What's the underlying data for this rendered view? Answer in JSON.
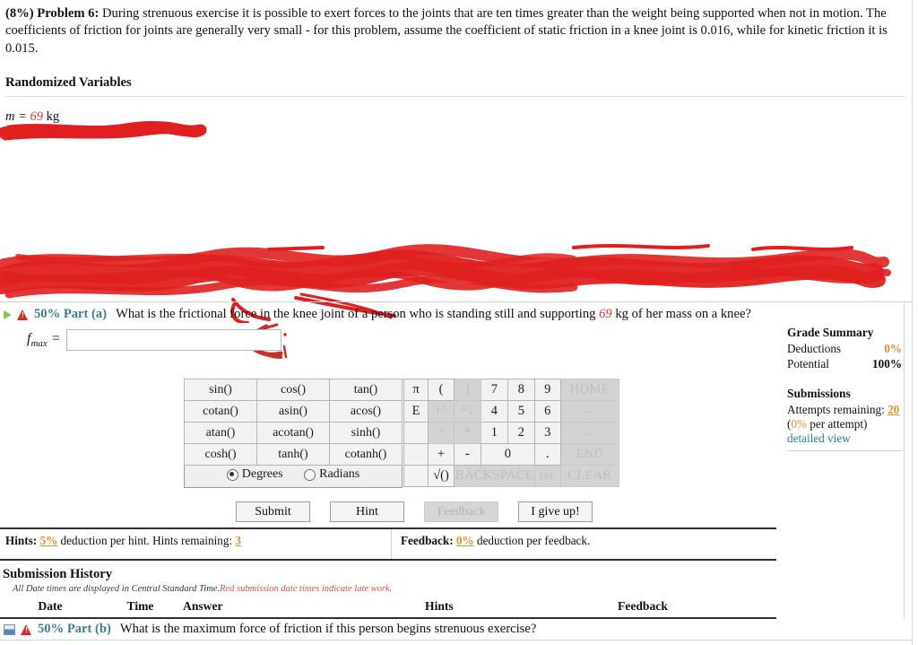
{
  "problem": {
    "percent": "(8%)",
    "number": "Problem 6:",
    "statement": "During strenuous exercise it is possible to exert forces to the joints that are ten times greater than the weight being supported when not in motion. The coefficients of friction for joints are generally very small - for this problem, assume the coefficient of static friction in a knee joint is 0.016, while for kinetic friction it is 0.015.",
    "randomized_title": "Randomized Variables",
    "variable_name": "m =",
    "variable_value": "69",
    "variable_unit": "kg"
  },
  "part_a": {
    "weight_label": "50% Part (a)",
    "question": "What is the frictional force in the knee joint of a person who is standing still and supporting 69 kg of her mass on a knee?",
    "question_pre": "What is the frictional force in the knee joint of a person who is standing still and supporting ",
    "question_value": "69",
    "question_post": " kg of her mass on a knee?",
    "answer_symbol": "f",
    "answer_subscript": "max",
    "answer_equals": "=",
    "answer_value": "",
    "answer_placeholder": ""
  },
  "calculator": {
    "functions": [
      [
        "sin()",
        "cos()",
        "tan()"
      ],
      [
        "cotan()",
        "asin()",
        "acos()"
      ],
      [
        "atan()",
        "acotan()",
        "sinh()"
      ],
      [
        "cosh()",
        "tanh()",
        "cotanh()"
      ]
    ],
    "angle_modes": [
      {
        "label": "Degrees",
        "selected": true
      },
      {
        "label": "Radians",
        "selected": false
      }
    ],
    "keypad_rows": [
      [
        {
          "label": "π",
          "kind": "pe",
          "disabled": false
        },
        {
          "label": "(",
          "kind": "op",
          "disabled": false
        },
        {
          "label": ")",
          "kind": "op",
          "disabled": true
        },
        {
          "label": "7",
          "kind": "num",
          "disabled": false
        },
        {
          "label": "8",
          "kind": "num",
          "disabled": false
        },
        {
          "label": "9",
          "kind": "num",
          "disabled": false
        },
        {
          "label": "HOME",
          "kind": "cmd",
          "disabled": true
        }
      ],
      [
        {
          "label": "E",
          "kind": "pe",
          "disabled": false
        },
        {
          "label": "↑^",
          "kind": "op",
          "disabled": true
        },
        {
          "label": "^↓",
          "kind": "op",
          "disabled": true
        },
        {
          "label": "4",
          "kind": "num",
          "disabled": false
        },
        {
          "label": "5",
          "kind": "num",
          "disabled": false
        },
        {
          "label": "6",
          "kind": "num",
          "disabled": false
        },
        {
          "label": "←",
          "kind": "cmd",
          "disabled": true
        }
      ],
      [
        {
          "label": "",
          "kind": "pe",
          "disabled": false
        },
        {
          "label": "/",
          "kind": "op",
          "disabled": true
        },
        {
          "label": "*",
          "kind": "op",
          "disabled": true
        },
        {
          "label": "1",
          "kind": "num",
          "disabled": false
        },
        {
          "label": "2",
          "kind": "num",
          "disabled": false
        },
        {
          "label": "3",
          "kind": "num",
          "disabled": false
        },
        {
          "label": "→",
          "kind": "cmd",
          "disabled": true
        }
      ],
      [
        {
          "label": "",
          "kind": "pe",
          "disabled": false
        },
        {
          "label": "+",
          "kind": "op",
          "disabled": false
        },
        {
          "label": "-",
          "kind": "op",
          "disabled": false
        },
        {
          "label": "0",
          "kind": "num2",
          "disabled": false
        },
        {
          "label": ".",
          "kind": "num",
          "disabled": false
        },
        {
          "label": "END",
          "kind": "cmd",
          "disabled": true
        }
      ],
      [
        {
          "label": "",
          "kind": "pe",
          "disabled": false
        },
        {
          "label": "√()",
          "kind": "op",
          "disabled": false
        },
        {
          "label": "BACKSPACE",
          "kind": "back",
          "disabled": true
        },
        {
          "label": "DEL",
          "kind": "num",
          "disabled": true
        },
        {
          "label": "CLEAR",
          "kind": "cmd",
          "disabled": true
        }
      ]
    ]
  },
  "actions": [
    {
      "label": "Submit",
      "disabled": false
    },
    {
      "label": "Hint",
      "disabled": false
    },
    {
      "label": "Feedback",
      "disabled": true
    },
    {
      "label": "I give up!",
      "disabled": false
    }
  ],
  "grade_summary": {
    "title": "Grade Summary",
    "deductions_label": "Deductions",
    "deductions_value": "0%",
    "potential_label": "Potential",
    "potential_value": "100%",
    "submissions_title": "Submissions",
    "attempts_label": "Attempts remaining:",
    "attempts_value": "20",
    "per_attempt_value": "0%",
    "per_attempt_suffix": " per attempt)",
    "per_attempt_prefix": "(",
    "detailed_view": "detailed view"
  },
  "hints_bar": {
    "hints_label": "Hints:",
    "hints_pct": "5%",
    "hints_text": "deduction per hint. Hints remaining:",
    "hints_remaining": "3",
    "feedback_label": "Feedback:",
    "feedback_pct": "0%",
    "feedback_text": "deduction per feedback."
  },
  "submission_history": {
    "title": "Submission History",
    "note_normal": "All Date times are displayed in Central Standard Time.",
    "note_late": "Red submission date times indicate late work.",
    "columns": [
      "Date",
      "Time",
      "Answer",
      "Hints",
      "Feedback"
    ],
    "rows": []
  },
  "part_b": {
    "weight_label": "50% Part (b)",
    "question": "What is the maximum force of friction if this person begins strenuous exercise?"
  },
  "colors": {
    "part_label": "#3b7e91",
    "orange": "#d9912b",
    "red_annotation": "#e02020",
    "warn_red": "#cf2f25",
    "link": "#2b7e9a"
  }
}
